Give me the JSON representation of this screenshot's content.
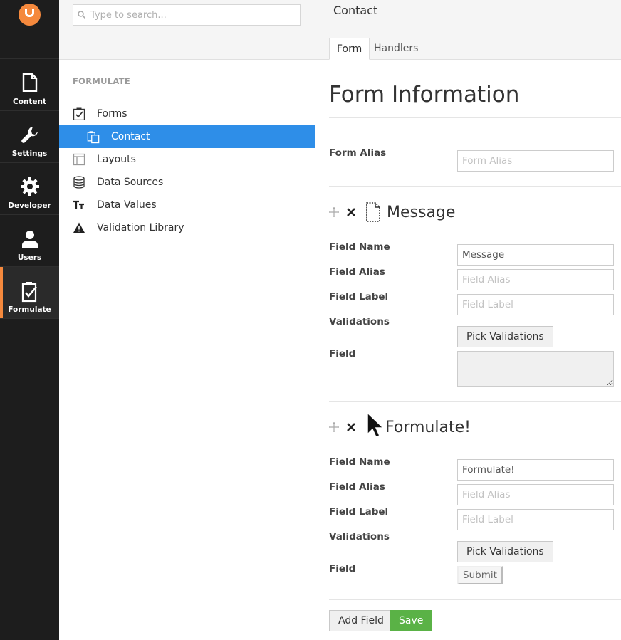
{
  "nav": {
    "items": [
      {
        "label": "Content",
        "icon": "document-icon"
      },
      {
        "label": "Settings",
        "icon": "wrench-icon"
      },
      {
        "label": "Developer",
        "icon": "gear-icon"
      },
      {
        "label": "Users",
        "icon": "user-icon"
      },
      {
        "label": "Formulate",
        "icon": "clipboard-check-icon"
      }
    ]
  },
  "tree": {
    "search_placeholder": "Type to search...",
    "section": "FORMULATE",
    "items": [
      {
        "label": "Forms"
      },
      {
        "label": "Contact"
      },
      {
        "label": "Layouts"
      },
      {
        "label": "Data Sources"
      },
      {
        "label": "Data Values"
      },
      {
        "label": "Validation Library"
      }
    ]
  },
  "main": {
    "title": "Contact",
    "tabs": [
      {
        "label": "Form"
      },
      {
        "label": "Handlers"
      }
    ],
    "heading": "Form Information",
    "form_alias_label": "Form Alias",
    "form_alias_placeholder": "Form Alias",
    "fields": [
      {
        "name": "Message",
        "field_name_label": "Field Name",
        "field_name_value": "Message",
        "field_alias_label": "Field Alias",
        "field_alias_placeholder": "Field Alias",
        "field_label_label": "Field Label",
        "field_label_placeholder": "Field Label",
        "validations_label": "Validations",
        "pick_validations": "Pick Validations",
        "field_label": "Field"
      },
      {
        "name": "Formulate!",
        "field_name_label": "Field Name",
        "field_name_value": "Formulate!",
        "field_alias_label": "Field Alias",
        "field_alias_placeholder": "Field Alias",
        "field_label_label": "Field Label",
        "field_label_placeholder": "Field Label",
        "validations_label": "Validations",
        "pick_validations": "Pick Validations",
        "field_label": "Field",
        "submit_label": "Submit"
      }
    ],
    "add_field": "Add Field",
    "save": "Save"
  },
  "colors": {
    "accent": "#f5893d",
    "selected": "#2e8ee8",
    "save": "#5ab246",
    "nav_bg": "#1d1d1d"
  }
}
